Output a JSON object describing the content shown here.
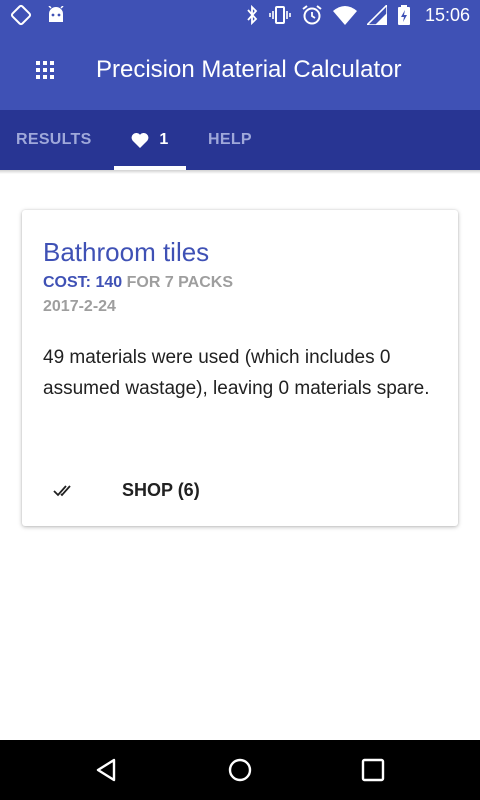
{
  "status_bar": {
    "time": "15:06",
    "icons": [
      "screen-rotation-icon",
      "android-icon",
      "bluetooth-icon",
      "vibrate-icon",
      "alarm-icon",
      "wifi-icon",
      "signal-icon",
      "battery-charging-icon"
    ]
  },
  "app_bar": {
    "title": "Precision Material Calculator",
    "menu_icon": "apps-grid-icon"
  },
  "tabs": {
    "results_label": "RESULTS",
    "favorites_count": "1",
    "favorites_icon": "heart-icon",
    "help_label": "HELP"
  },
  "card": {
    "title": "Bathroom tiles",
    "cost_label": "COST:",
    "cost_value": "140",
    "cost_suffix": "FOR 7 PACKS",
    "date": "2017-2-24",
    "description": "49 materials were used (which includes 0 assumed wastage), leaving 0 materials spare.",
    "action_icon": "double-check-icon",
    "action_label": "SHOP (6)"
  },
  "nav_bar": {
    "icons": [
      "back-icon",
      "home-icon",
      "recents-icon"
    ]
  },
  "colors": {
    "primary": "#3F51B5",
    "primary_dark": "#283593",
    "tab_inactive": "#9FA8DA",
    "secondary_text": "#9E9E9E"
  }
}
